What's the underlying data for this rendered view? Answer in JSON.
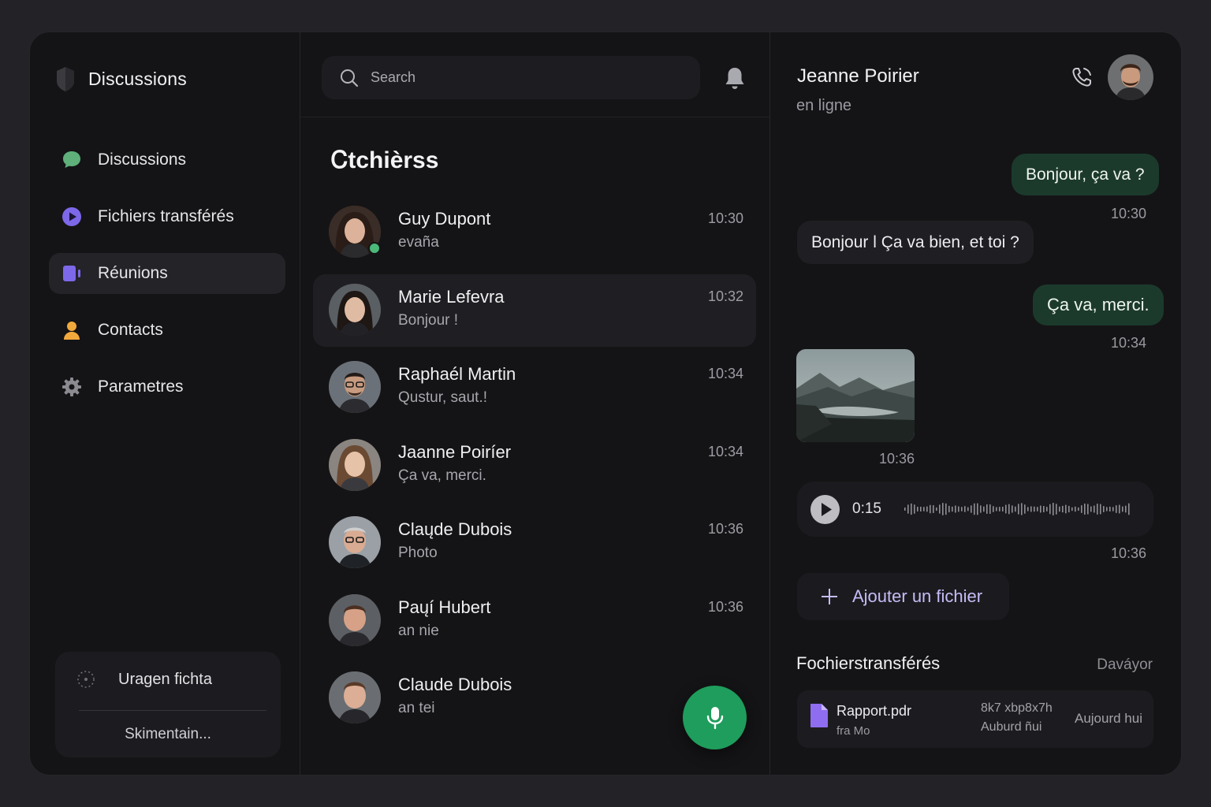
{
  "sidebar": {
    "title": "Discussions",
    "nav": [
      {
        "label": "Discussions",
        "icon": "chat-bubble-icon",
        "color": "#5fb07a"
      },
      {
        "label": "Fichiers transférés",
        "icon": "play-circle-icon",
        "color": "#7c68e8"
      },
      {
        "label": "Réunions",
        "icon": "video-camera-icon",
        "color": "#7c68e8",
        "active": true
      },
      {
        "label": "Contacts",
        "icon": "person-icon",
        "color": "#f2a93b"
      },
      {
        "label": "Parametres",
        "icon": "gear-icon",
        "color": "#8a8a90"
      }
    ],
    "storage": {
      "title": "Uragen fichta",
      "subtitle": "Skimentain..."
    }
  },
  "list": {
    "search_placeholder": "Search",
    "title": "Ꮯtchièrss",
    "conversations": [
      {
        "name": "Guy Dupont",
        "preview": "evaña",
        "time": "10:30",
        "online": true
      },
      {
        "name": "Marie Lefevra",
        "preview": "Bonjour !",
        "time": "10:32",
        "active": true
      },
      {
        "name": "Raphaél Martin",
        "preview": "Qustur, saut.!",
        "time": "10:34"
      },
      {
        "name": "Jaanne Poiríer",
        "preview": "Ça va, merci.",
        "time": "10:34"
      },
      {
        "name": "Claųde Dubois",
        "preview": "Photo",
        "time": "10:36"
      },
      {
        "name": "Paųí Hubert",
        "preview": "an nie",
        "time": "10:36"
      },
      {
        "name": "Claude Dubois",
        "preview": "an tei",
        "time": ""
      }
    ]
  },
  "chat": {
    "contact_name": "Jeanne Poirier",
    "status": "en ligne",
    "messages": [
      {
        "direction": "out",
        "text": "Bonjour, ça va ?",
        "time": "10:30"
      },
      {
        "direction": "in",
        "text": "Bonjour l Ça va bien, et toi ?",
        "time": ""
      },
      {
        "direction": "out",
        "text": "Ça va, merci.",
        "time": "10:34"
      }
    ],
    "photo_time": "10:36",
    "voice": {
      "duration": "0:15",
      "time": "10:36"
    },
    "add_file_label": "Ajouter un fichier",
    "files_title": "Fochierstransférés",
    "files_link": "Daváyor",
    "file": {
      "name": "Rapport.pdr",
      "sub": "fra Mo",
      "meta1": "8k7 xbp8x7h",
      "meta2": "Auburd ñui",
      "date": "Aujourd hui"
    }
  },
  "colors": {
    "accent_green": "#1f9d5c",
    "outgoing_bubble": "#1c3a2c",
    "accent_purple": "#7c68e8"
  }
}
